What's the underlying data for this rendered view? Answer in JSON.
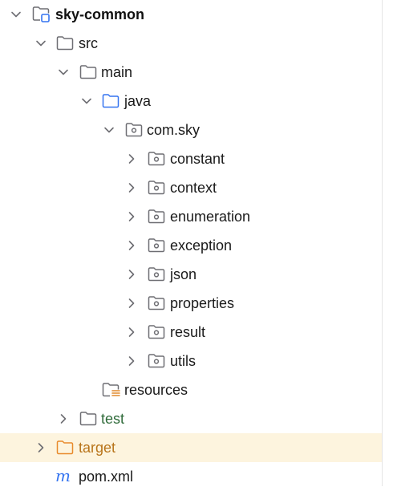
{
  "tree": {
    "items": [
      {
        "label": "sky-common",
        "icon": "module-folder-icon",
        "chevron": "down"
      },
      {
        "label": "src",
        "icon": "folder-icon",
        "chevron": "down"
      },
      {
        "label": "main",
        "icon": "folder-icon",
        "chevron": "down"
      },
      {
        "label": "java",
        "icon": "source-root-folder-icon",
        "chevron": "down"
      },
      {
        "label": "com.sky",
        "icon": "package-icon",
        "chevron": "down"
      },
      {
        "label": "constant",
        "icon": "package-icon",
        "chevron": "right"
      },
      {
        "label": "context",
        "icon": "package-icon",
        "chevron": "right"
      },
      {
        "label": "enumeration",
        "icon": "package-icon",
        "chevron": "right"
      },
      {
        "label": "exception",
        "icon": "package-icon",
        "chevron": "right"
      },
      {
        "label": "json",
        "icon": "package-icon",
        "chevron": "right"
      },
      {
        "label": "properties",
        "icon": "package-icon",
        "chevron": "right"
      },
      {
        "label": "result",
        "icon": "package-icon",
        "chevron": "right"
      },
      {
        "label": "utils",
        "icon": "package-icon",
        "chevron": "right"
      },
      {
        "label": "resources",
        "icon": "resources-folder-icon",
        "chevron": "none"
      },
      {
        "label": "test",
        "icon": "folder-icon",
        "chevron": "right"
      },
      {
        "label": "target",
        "icon": "excluded-folder-icon",
        "chevron": "right",
        "highlighted": true
      },
      {
        "label": "pom.xml",
        "icon": "maven-icon",
        "chevron": "none"
      }
    ]
  },
  "colors": {
    "folder_stroke": "#6e6e73",
    "source_root_stroke": "#3574f0",
    "excluded_folder_stroke": "#e88a2b",
    "maven_blue": "#3574f0",
    "resources_accent": "#e08a2e",
    "highlight_row": "#fdf4de",
    "test_label": "#2f6b3a",
    "target_label": "#b8741a"
  }
}
